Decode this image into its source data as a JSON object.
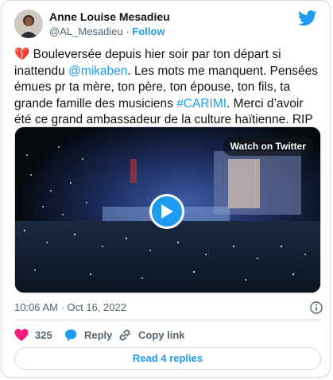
{
  "author": {
    "name": "Anne Louise Mesadieu",
    "handle": "@AL_Mesadieu",
    "separator": "·",
    "follow_label": "Follow"
  },
  "tweet": {
    "line1_emoji": "💔",
    "line1_text": " Bouleversée depuis hier soir par ton départ si inattendu",
    "mention": "@mikaben",
    "after_mention": ". Les mots me manquent. Pensées émues pr ta mère, ton père, ton épouse, ton fils, ta grande famille des musiciens ",
    "hashtag": "#CARIMI",
    "after_hashtag": ". Merci d’avoir été ce grand ambassadeur de la culture haïtienne. RIP",
    "end_emoji": "❤️"
  },
  "media": {
    "watch_label": "Watch on Twitter"
  },
  "timestamp": {
    "time": "10:06 AM",
    "separator": "·",
    "date": "Oct 16, 2022"
  },
  "actions": {
    "like_count": "325",
    "reply_label": "Reply",
    "copy_link_label": "Copy link"
  },
  "replies_button": "Read 4 replies",
  "colors": {
    "accent": "#1d9bf0",
    "like": "#f91880",
    "text": "#0f1419",
    "secondary": "#536471",
    "border": "#cfd9de"
  }
}
